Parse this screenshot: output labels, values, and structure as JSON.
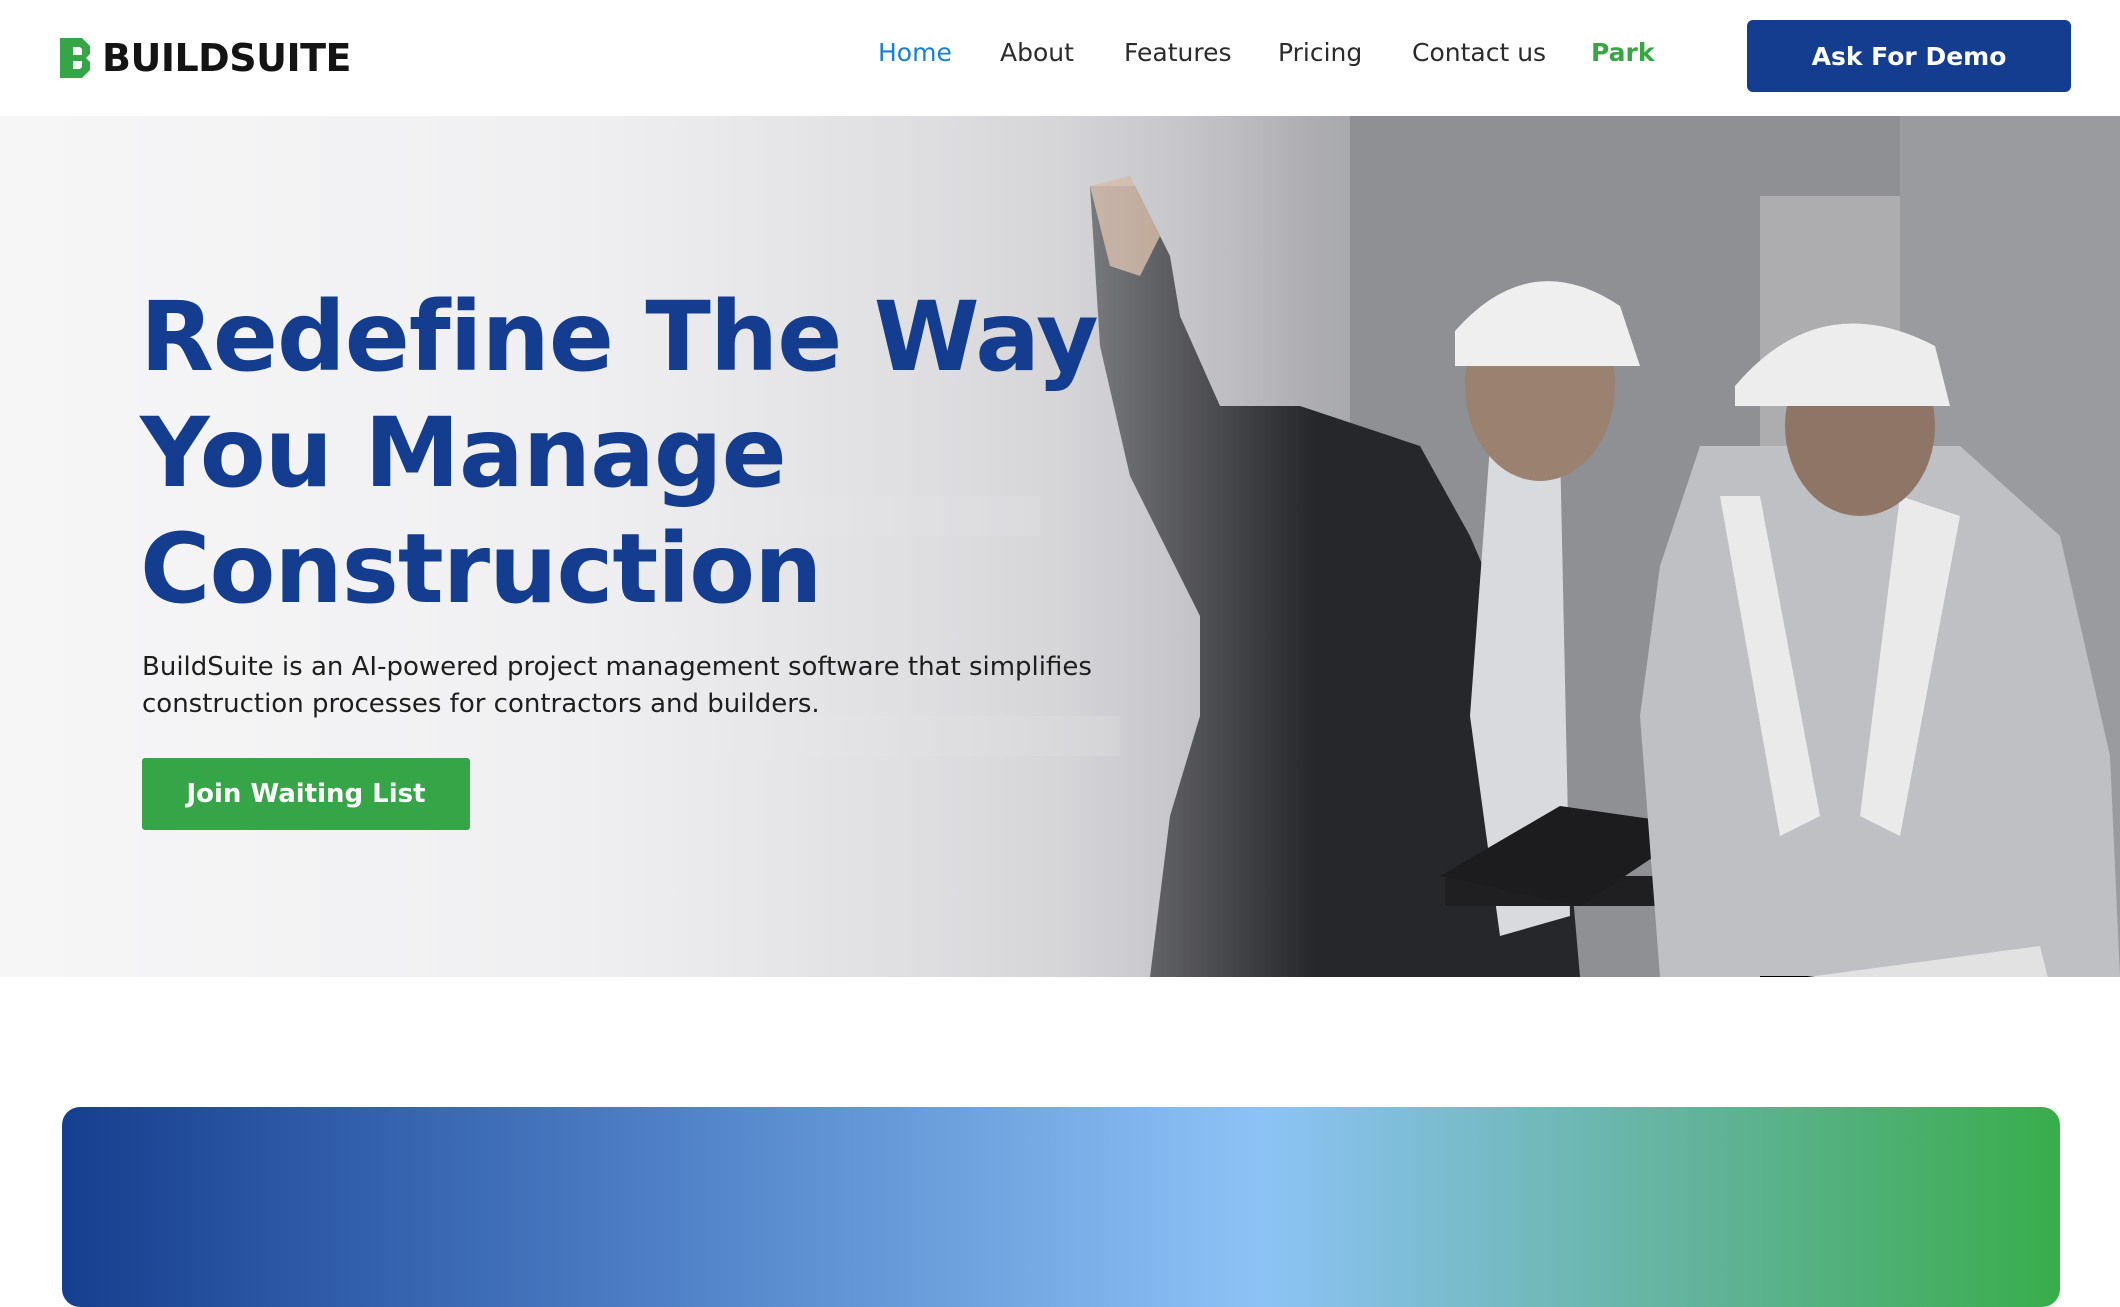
{
  "brand": {
    "name": "BUILDSUITE",
    "logo_icon": "buildsuite-logo-icon",
    "colors": {
      "primary": "#143d8f",
      "green": "#36a548",
      "active_link": "#1a7fd0"
    }
  },
  "nav": {
    "items": [
      {
        "label": "Home",
        "active": true
      },
      {
        "label": "About",
        "active": false
      },
      {
        "label": "Features",
        "active": false
      },
      {
        "label": "Pricing",
        "active": false
      },
      {
        "label": "Contact us",
        "active": false
      },
      {
        "label": "Park",
        "active": false,
        "highlight": true
      }
    ],
    "demo_button": "Ask For Demo"
  },
  "hero": {
    "title_lines": [
      "Redefine The Way",
      "You Manage",
      "Construction"
    ],
    "description_lines": [
      "BuildSuite is an AI-powered project management software that simplifies",
      "construction processes for contractors and builders."
    ],
    "cta": "Join Waiting List",
    "image_subject": "two-construction-engineers-photo"
  }
}
